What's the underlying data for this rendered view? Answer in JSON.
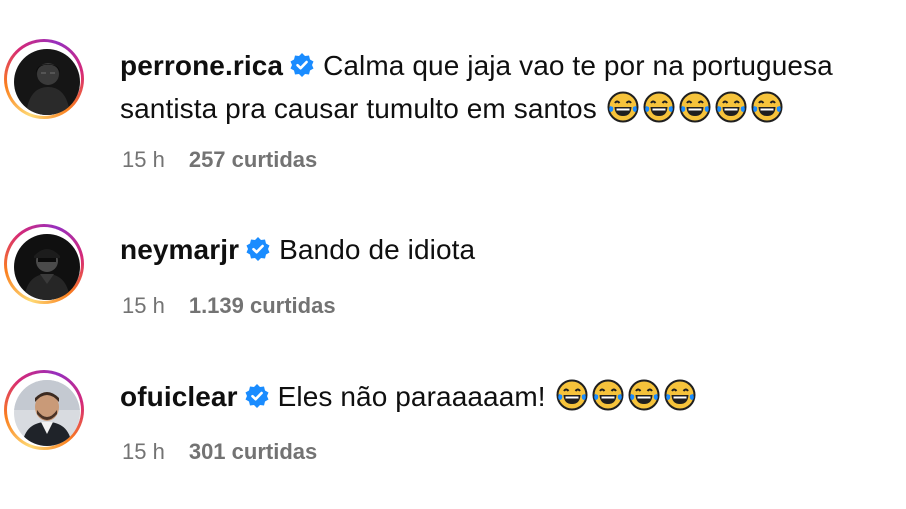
{
  "comments": [
    {
      "username": "perrone.rica",
      "text_line1": "Calma que jaja vao te por na portuguesa",
      "text_line2": "santista pra causar tumulto em santos",
      "emoji_count": 5,
      "time": "15 h",
      "likes": "257 curtidas",
      "avatar_icon": "dark-hooded-figure"
    },
    {
      "username": "neymarjr",
      "text": "Bando de idiota",
      "time": "15 h",
      "likes": "1.139 curtidas",
      "avatar_icon": "dark-portrait-cap"
    },
    {
      "username": "ofuiclear",
      "text": "Eles não paraaaaam!",
      "emoji_count": 4,
      "time": "15 h",
      "likes": "301 curtidas",
      "avatar_icon": "man-portrait"
    }
  ],
  "colors": {
    "verified_badge": "#1a8cff",
    "meta_text": "#737373",
    "emoji_face": "#f6c33b"
  }
}
